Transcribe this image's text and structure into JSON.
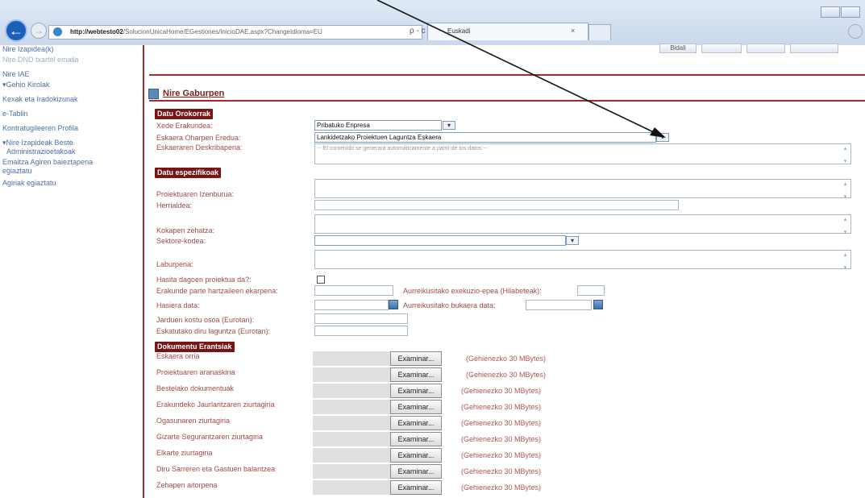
{
  "browser": {
    "url_host": "http://webtesto02",
    "url_path": "/SolucionUnicaHome/EGestiones/InicioDAE.aspx?ChangeIdioma=EU",
    "url_tools": "ρ - c",
    "tab_title": "Euskadi"
  },
  "top_buttons": [
    "Bidali",
    "",
    "",
    ""
  ],
  "sidebar": {
    "items": [
      {
        "label": "Nire Izapidea(k)"
      },
      {
        "label": "Nire DND txartel emaila"
      },
      {
        "label": "Nire IAE"
      },
      {
        "label": "Gehio Kirolak"
      },
      {
        "label": "Kexak eta Iradokizunak"
      },
      {
        "label": "e-Tablin"
      },
      {
        "label": "Kontratugileeren Profila"
      },
      {
        "label": "Nire Izapideak Beste"
      },
      {
        "label": "Administrazioetakoak"
      },
      {
        "label": "Emaitza Agiren baieztapena"
      },
      {
        "label": "egiaztatu"
      },
      {
        "label": "Agiriak egiaztatu"
      }
    ]
  },
  "page": {
    "title": "Nire Gaburpen"
  },
  "sections": {
    "general": "Datu Orokorrak",
    "specific": "Datu espezifikoak",
    "attachments": "Dokumentu Erantsiak"
  },
  "general": {
    "entity_label": "Xede Erakundea:",
    "entity_value": "Pribatuko Enpresa",
    "request_model_label": "Eskaera Oharpen Eredua:",
    "request_model_value": "Lankidetzako Proiektuen Laguntza Eskaera",
    "description_label": "Eskaeraren Deskribapena:",
    "description_placeholder": "-- El contenido se generará automáticamente a partir de los datos --"
  },
  "specific": {
    "project_name": "Proiektuaren Izenburua:",
    "country": "Herrialdea:",
    "location": "Kokapen zehatza:",
    "sector_code": "Sektore-kodea:",
    "summary": "Laburpena:",
    "started": "Hasita dagoen proiektua da?:",
    "partner_contribution": "Erakunde parte hartzaileen ekarpena:",
    "forecast_period": "Aurreikusitako exekuzio-epea (Hilabeteak):",
    "start_date": "Hasiera data:",
    "forecast_end": "Aurreikusitako bukaera data:",
    "total_cost": "Jarduen kostu osoa (Eurotan):",
    "requested_amount": "Eskatutako diru laguntza (Eurotan):"
  },
  "attachments": {
    "browse_label": "Examinar...",
    "max_note": "(Gehienezko 30 MBytes)",
    "items": [
      {
        "label": "Eskaera orria"
      },
      {
        "label": "Proiektuaren aranaskina"
      },
      {
        "label": "Bestelako dokumentuak"
      },
      {
        "label": "Erakundeko Jaurlaritzaren ziurtagiria"
      },
      {
        "label": "Ogasunaren ziurtagiria"
      },
      {
        "label": "Gizarte Segurantzaren ziurtagiria"
      },
      {
        "label": "Elkarte ziurtagiria"
      },
      {
        "label": "Diru Sarreren eta Gastuen balantzea"
      },
      {
        "label": "Zehapen aitorpena"
      }
    ]
  }
}
